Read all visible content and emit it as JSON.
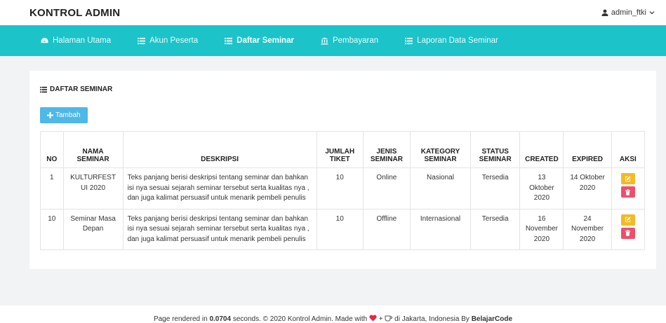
{
  "app": {
    "brand": "KONTROL ADMIN",
    "user": "admin_ftki"
  },
  "nav": [
    {
      "label": "Halaman Utama",
      "icon": "dashboard-icon"
    },
    {
      "label": "Akun Peserta",
      "icon": "list-icon"
    },
    {
      "label": "Daftar Seminar",
      "icon": "list-icon",
      "active": true
    },
    {
      "label": "Pembayaran",
      "icon": "bank-icon"
    },
    {
      "label": "Laporan Data Seminar",
      "icon": "list-icon"
    }
  ],
  "panel": {
    "title": "DAFTAR SEMINAR",
    "add_label": "Tambah"
  },
  "table": {
    "headers": [
      "NO",
      "NAMA SEMINAR",
      "DESKRIPSI",
      "JUMLAH TIKET",
      "JENIS SEMINAR",
      "KATEGORY SEMINAR",
      "STATUS SEMINAR",
      "CREATED",
      "EXPIRED",
      "AKSI"
    ],
    "rows": [
      {
        "no": "1",
        "nama": "KULTURFEST UI 2020",
        "deskripsi": "Teks panjang berisi deskripsi tentang seminar dan bahkan isi nya sesuai sejarah seminar tersebut serta kualitas nya , dan juga kalimat persuasif untuk menarik pembeli penulis",
        "tiket": "10",
        "jenis": "Online",
        "kategori": "Nasional",
        "status": "Tersedia",
        "created": "13 Oktober 2020",
        "expired": "14 Oktober 2020"
      },
      {
        "no": "10",
        "nama": "Seminar Masa Depan",
        "deskripsi": "Teks panjang berisi deskripsi tentang seminar dan bahkan isi nya sesuai sejarah seminar tersebut serta kualitas nya , dan juga kalimat persuasif untuk menarik pembeli penulis",
        "tiket": "10",
        "jenis": "Offline",
        "kategori": "Internasional",
        "status": "Tersedia",
        "created": "16 November 2020",
        "expired": "24 November 2020"
      }
    ]
  },
  "footer": {
    "prefix": "Page rendered in ",
    "time": "0.0704",
    "middle": " seconds. © 2020 Kontrol Admin. Made with ",
    "plus": " + ",
    "suffix": " di Jakarta, Indonesia By ",
    "author": "BelajarCode"
  },
  "colors": {
    "nav_bg": "#1cc3c8",
    "add_button": "#4fb8e6",
    "edit_button": "#f4b923",
    "delete_button": "#ef4e6a",
    "heart": "#e8283f"
  }
}
